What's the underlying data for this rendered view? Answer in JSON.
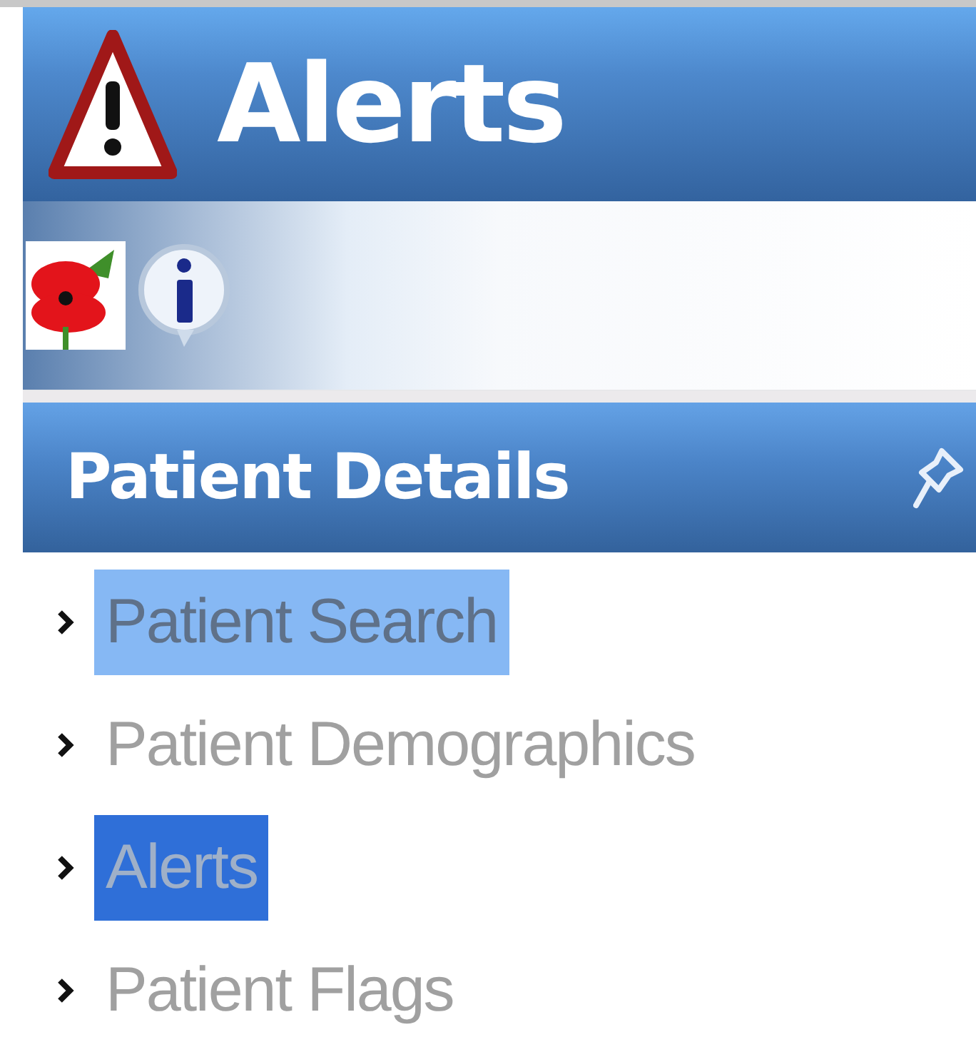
{
  "header": {
    "title": "Alerts"
  },
  "panel": {
    "title": "Patient Details",
    "items": [
      {
        "label": "Patient Search",
        "hovered": true,
        "selected": false
      },
      {
        "label": "Patient Demographics",
        "hovered": false,
        "selected": false
      },
      {
        "label": "Alerts",
        "hovered": false,
        "selected": true
      },
      {
        "label": "Patient Flags",
        "hovered": false,
        "selected": false
      }
    ]
  }
}
